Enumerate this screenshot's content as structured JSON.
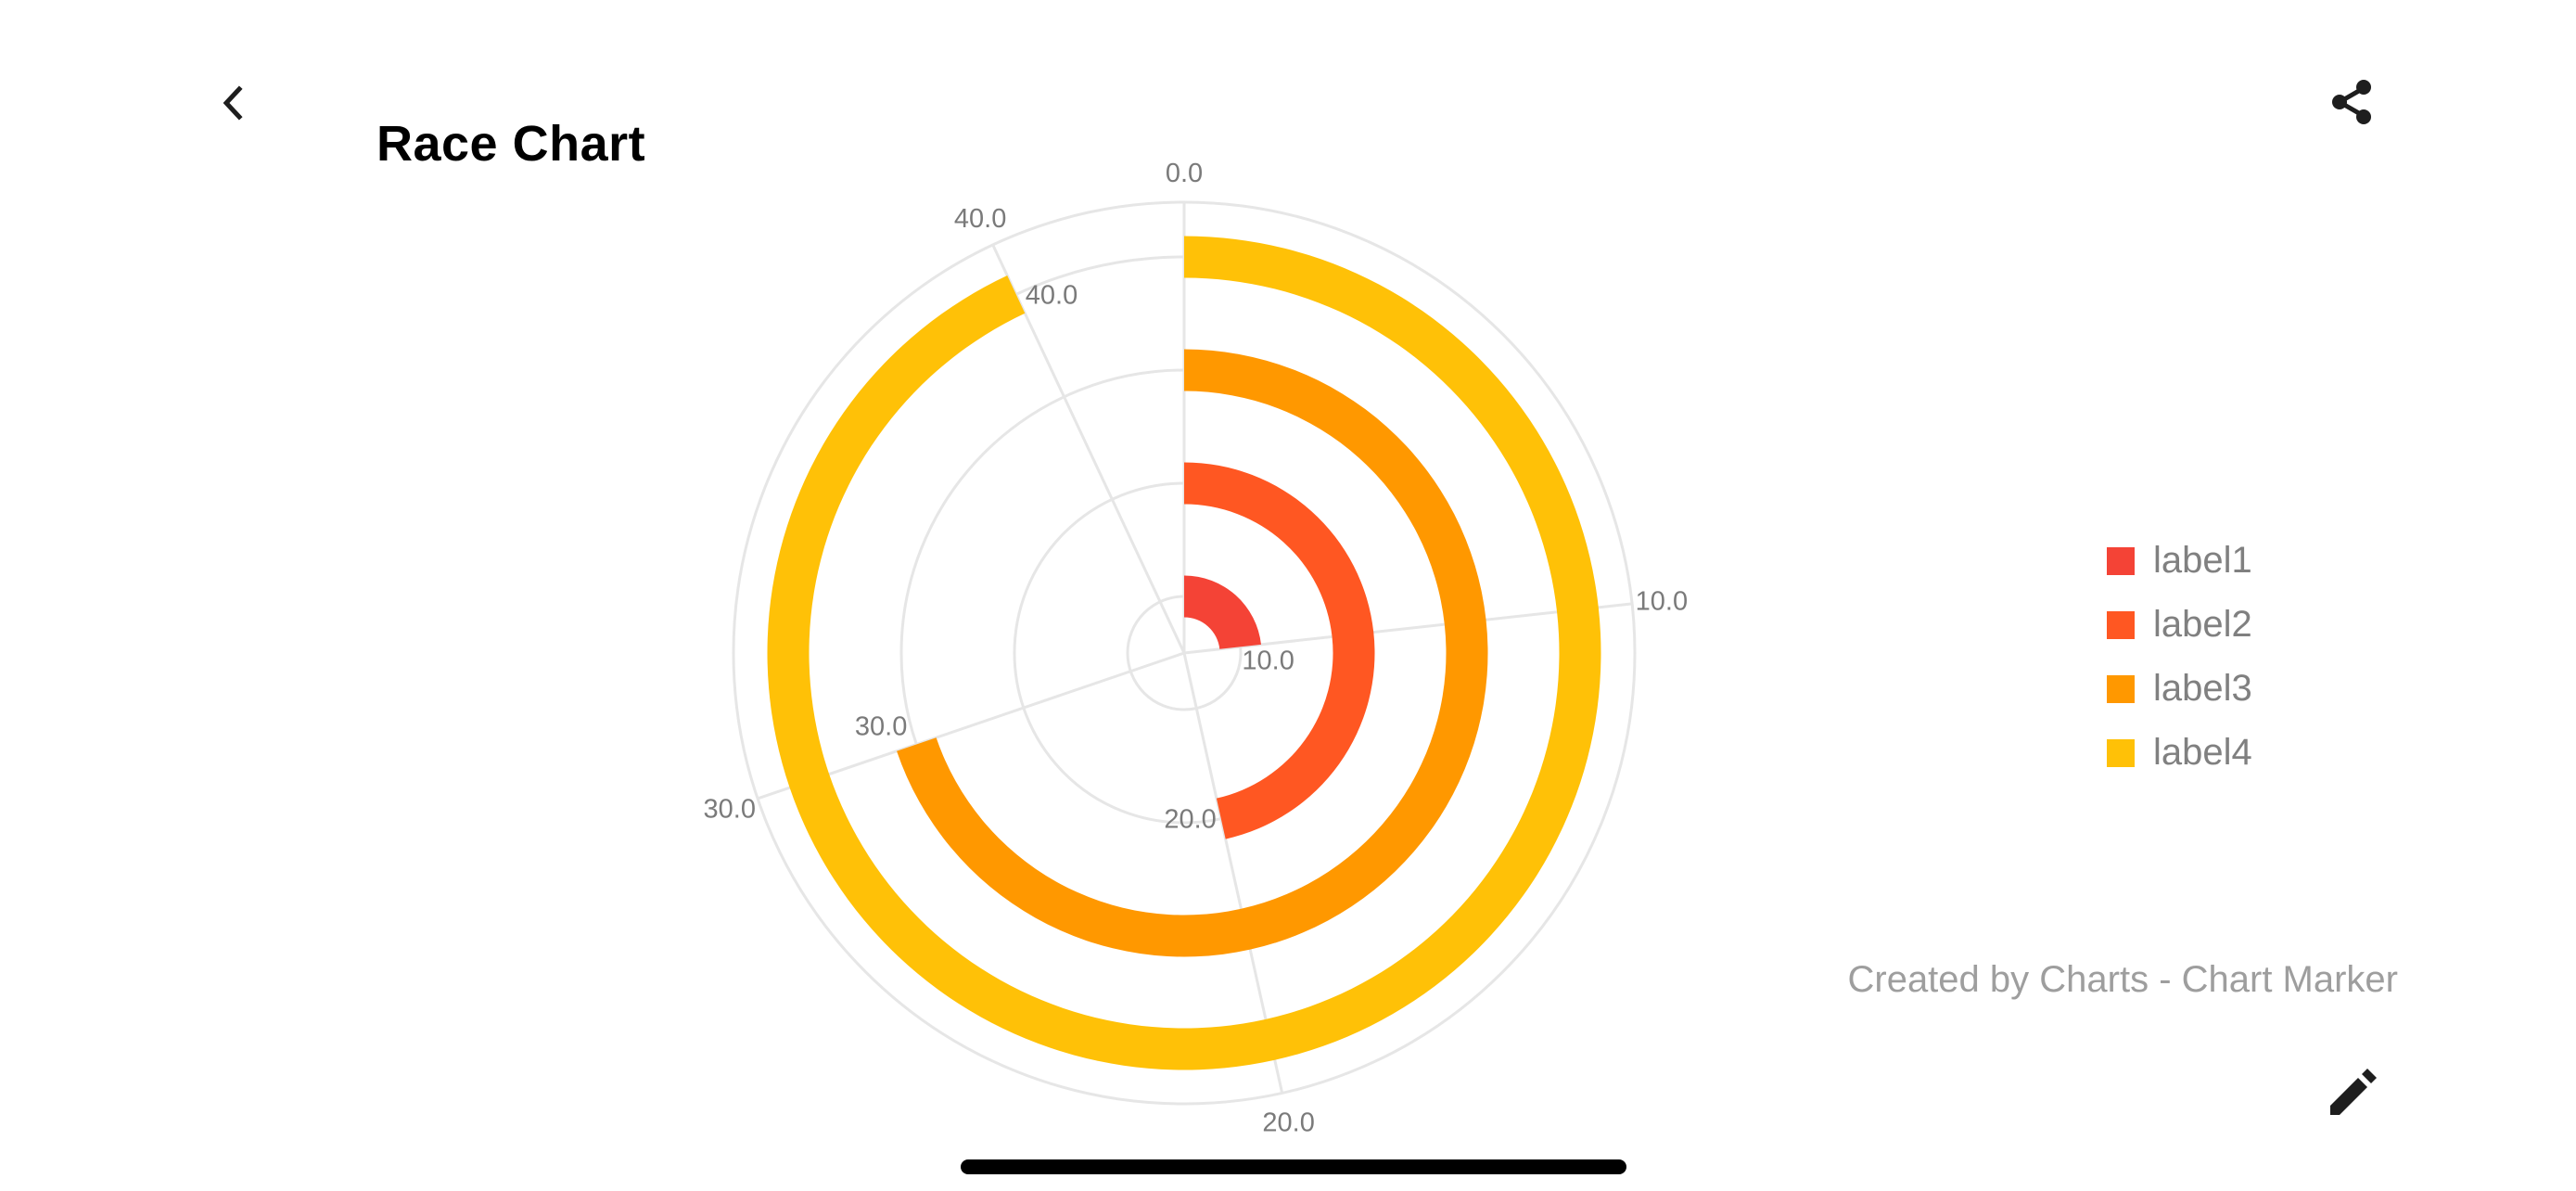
{
  "header": {
    "title": "Race Chart",
    "back_icon": "chevron-left-icon",
    "share_icon": "share-icon"
  },
  "footer": {
    "credit": "Created by Charts - Chart Marker",
    "edit_icon": "pencil-icon"
  },
  "chart_data": {
    "type": "polar-bar",
    "title": "Race Chart",
    "categories": [
      "label1",
      "label2",
      "label3",
      "label4"
    ],
    "values": [
      10.0,
      20.0,
      30.0,
      40.0
    ],
    "value_labels": [
      "10.0",
      "20.0",
      "30.0",
      "40.0"
    ],
    "colors": [
      "#F44336",
      "#FF5722",
      "#FF9800",
      "#FFC107"
    ],
    "angle_axis": {
      "min": 0,
      "max": 43,
      "ticks": [
        0,
        10,
        20,
        30,
        40
      ],
      "tick_labels": [
        "0.0",
        "10.0",
        "20.0",
        "30.0",
        "40.0"
      ],
      "start": "top",
      "direction": "clockwise"
    },
    "grid": true,
    "legend": {
      "position": "right",
      "entries": [
        {
          "label": "label1",
          "color": "#F44336"
        },
        {
          "label": "label2",
          "color": "#FF5722"
        },
        {
          "label": "label3",
          "color": "#FF9800"
        },
        {
          "label": "label4",
          "color": "#FFC107"
        }
      ]
    }
  }
}
